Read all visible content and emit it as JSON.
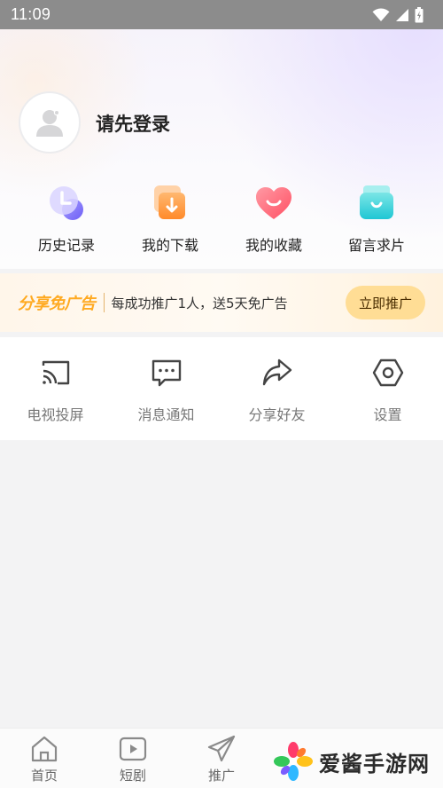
{
  "status_bar": {
    "time": "11:09"
  },
  "profile": {
    "login_prompt": "请先登录"
  },
  "quick_actions": [
    {
      "label": "历史记录",
      "icon": "history-icon"
    },
    {
      "label": "我的下载",
      "icon": "download-icon"
    },
    {
      "label": "我的收藏",
      "icon": "favorite-heart-icon"
    },
    {
      "label": "留言求片",
      "icon": "message-request-icon"
    }
  ],
  "promo": {
    "brand": "分享免广告",
    "description": "每成功推广1人，送5天免广告",
    "button": "立即推广"
  },
  "tools": [
    {
      "label": "电视投屏",
      "icon": "cast-icon"
    },
    {
      "label": "消息通知",
      "icon": "message-icon"
    },
    {
      "label": "分享好友",
      "icon": "share-icon"
    },
    {
      "label": "设置",
      "icon": "settings-hexagon-icon"
    }
  ],
  "tabbar": [
    {
      "label": "首页",
      "icon": "home-icon"
    },
    {
      "label": "短剧",
      "icon": "play-icon"
    },
    {
      "label": "推广",
      "icon": "paper-plane-icon"
    }
  ],
  "watermark": {
    "text": "爱酱手游网"
  },
  "colors": {
    "promo_brand": "#ffaa22",
    "promo_button": "#ffdd95",
    "status_bar": "#8c8c8c"
  }
}
